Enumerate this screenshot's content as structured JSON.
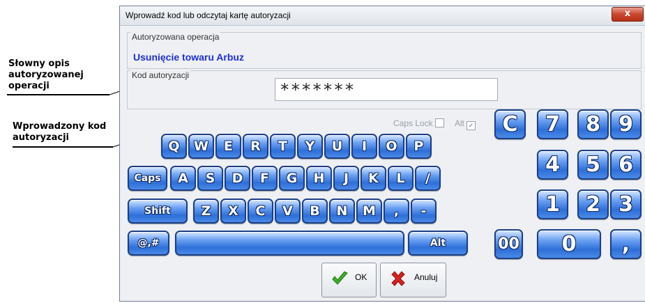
{
  "annotations": {
    "description": "Słowny opis autoryzowanej operacji",
    "code": "Wprowadzony kod autoryzacji"
  },
  "window": {
    "title": "Wprowadź kod lub odczytaj kartę autoryzacji",
    "close_label": "x"
  },
  "operation_group": {
    "title": "Autoryzowana operacja",
    "value": "Usunięcie towaru Arbuz"
  },
  "code_group": {
    "title": "Kod autoryzacji",
    "value": "*******"
  },
  "flags": {
    "caps_lock_label": "Caps Lock",
    "caps_lock_checked": false,
    "alt_label": "Alt",
    "alt_checked": true
  },
  "keyboard": {
    "row1": [
      "Q",
      "W",
      "E",
      "R",
      "T",
      "Y",
      "U",
      "I",
      "O",
      "P"
    ],
    "row2": [
      "Caps",
      "A",
      "S",
      "D",
      "F",
      "G",
      "H",
      "J",
      "K",
      "L",
      "/"
    ],
    "row3": [
      "Shift",
      "Z",
      "X",
      "C",
      "V",
      "B",
      "N",
      "M",
      ",",
      "-"
    ],
    "row4": [
      "@,#",
      "",
      "Alt"
    ]
  },
  "numpad": {
    "row1": [
      "C",
      "7",
      "8",
      "9"
    ],
    "row2": [
      "4",
      "5",
      "6"
    ],
    "row3": [
      "1",
      "2",
      "3"
    ],
    "row4": [
      "00",
      "0",
      ","
    ]
  },
  "buttons": {
    "ok": "OK",
    "cancel": "Anuluj"
  },
  "colors": {
    "key_fill": "#2e6fd9",
    "operation_text": "#1d2fd6",
    "ok_icon": "#3fae2a",
    "cancel_icon": "#d92020"
  }
}
